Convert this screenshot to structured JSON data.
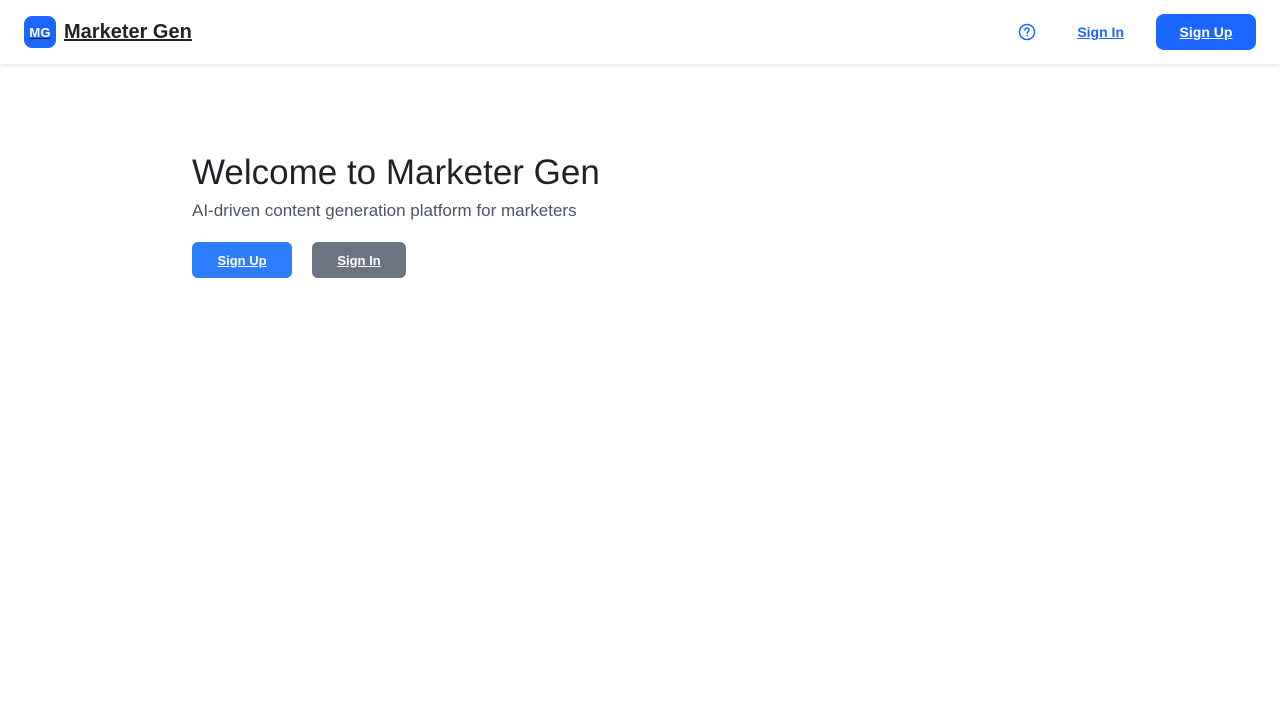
{
  "header": {
    "logo_text": "MG",
    "brand_name": "Marketer Gen",
    "help_icon": "question-circle-icon",
    "signin_label": "Sign In",
    "signup_label": "Sign Up"
  },
  "hero": {
    "title": "Welcome to Marketer Gen",
    "subtitle": "AI-driven content generation platform for marketers",
    "primary_label": "Sign Up",
    "secondary_label": "Sign In"
  },
  "colors": {
    "accent": "#1a66ff",
    "primary_button": "#2f7dff",
    "secondary_button": "#6c7483",
    "title_text": "#1f2329",
    "subtitle_text": "#4a5565"
  }
}
